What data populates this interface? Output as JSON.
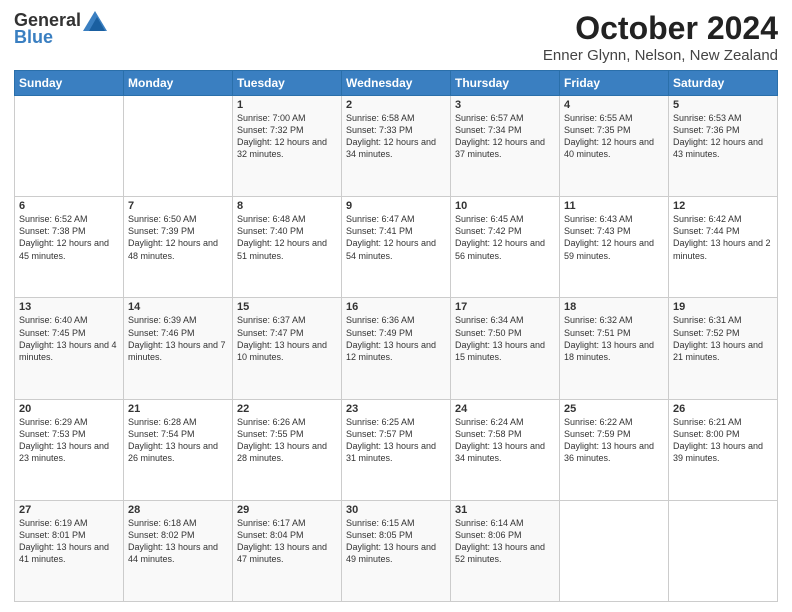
{
  "header": {
    "logo_general": "General",
    "logo_blue": "Blue",
    "title": "October 2024",
    "subtitle": "Enner Glynn, Nelson, New Zealand"
  },
  "days_of_week": [
    "Sunday",
    "Monday",
    "Tuesday",
    "Wednesday",
    "Thursday",
    "Friday",
    "Saturday"
  ],
  "weeks": [
    [
      {
        "day": "",
        "info": ""
      },
      {
        "day": "",
        "info": ""
      },
      {
        "day": "1",
        "info": "Sunrise: 7:00 AM\nSunset: 7:32 PM\nDaylight: 12 hours and 32 minutes."
      },
      {
        "day": "2",
        "info": "Sunrise: 6:58 AM\nSunset: 7:33 PM\nDaylight: 12 hours and 34 minutes."
      },
      {
        "day": "3",
        "info": "Sunrise: 6:57 AM\nSunset: 7:34 PM\nDaylight: 12 hours and 37 minutes."
      },
      {
        "day": "4",
        "info": "Sunrise: 6:55 AM\nSunset: 7:35 PM\nDaylight: 12 hours and 40 minutes."
      },
      {
        "day": "5",
        "info": "Sunrise: 6:53 AM\nSunset: 7:36 PM\nDaylight: 12 hours and 43 minutes."
      }
    ],
    [
      {
        "day": "6",
        "info": "Sunrise: 6:52 AM\nSunset: 7:38 PM\nDaylight: 12 hours and 45 minutes."
      },
      {
        "day": "7",
        "info": "Sunrise: 6:50 AM\nSunset: 7:39 PM\nDaylight: 12 hours and 48 minutes."
      },
      {
        "day": "8",
        "info": "Sunrise: 6:48 AM\nSunset: 7:40 PM\nDaylight: 12 hours and 51 minutes."
      },
      {
        "day": "9",
        "info": "Sunrise: 6:47 AM\nSunset: 7:41 PM\nDaylight: 12 hours and 54 minutes."
      },
      {
        "day": "10",
        "info": "Sunrise: 6:45 AM\nSunset: 7:42 PM\nDaylight: 12 hours and 56 minutes."
      },
      {
        "day": "11",
        "info": "Sunrise: 6:43 AM\nSunset: 7:43 PM\nDaylight: 12 hours and 59 minutes."
      },
      {
        "day": "12",
        "info": "Sunrise: 6:42 AM\nSunset: 7:44 PM\nDaylight: 13 hours and 2 minutes."
      }
    ],
    [
      {
        "day": "13",
        "info": "Sunrise: 6:40 AM\nSunset: 7:45 PM\nDaylight: 13 hours and 4 minutes."
      },
      {
        "day": "14",
        "info": "Sunrise: 6:39 AM\nSunset: 7:46 PM\nDaylight: 13 hours and 7 minutes."
      },
      {
        "day": "15",
        "info": "Sunrise: 6:37 AM\nSunset: 7:47 PM\nDaylight: 13 hours and 10 minutes."
      },
      {
        "day": "16",
        "info": "Sunrise: 6:36 AM\nSunset: 7:49 PM\nDaylight: 13 hours and 12 minutes."
      },
      {
        "day": "17",
        "info": "Sunrise: 6:34 AM\nSunset: 7:50 PM\nDaylight: 13 hours and 15 minutes."
      },
      {
        "day": "18",
        "info": "Sunrise: 6:32 AM\nSunset: 7:51 PM\nDaylight: 13 hours and 18 minutes."
      },
      {
        "day": "19",
        "info": "Sunrise: 6:31 AM\nSunset: 7:52 PM\nDaylight: 13 hours and 21 minutes."
      }
    ],
    [
      {
        "day": "20",
        "info": "Sunrise: 6:29 AM\nSunset: 7:53 PM\nDaylight: 13 hours and 23 minutes."
      },
      {
        "day": "21",
        "info": "Sunrise: 6:28 AM\nSunset: 7:54 PM\nDaylight: 13 hours and 26 minutes."
      },
      {
        "day": "22",
        "info": "Sunrise: 6:26 AM\nSunset: 7:55 PM\nDaylight: 13 hours and 28 minutes."
      },
      {
        "day": "23",
        "info": "Sunrise: 6:25 AM\nSunset: 7:57 PM\nDaylight: 13 hours and 31 minutes."
      },
      {
        "day": "24",
        "info": "Sunrise: 6:24 AM\nSunset: 7:58 PM\nDaylight: 13 hours and 34 minutes."
      },
      {
        "day": "25",
        "info": "Sunrise: 6:22 AM\nSunset: 7:59 PM\nDaylight: 13 hours and 36 minutes."
      },
      {
        "day": "26",
        "info": "Sunrise: 6:21 AM\nSunset: 8:00 PM\nDaylight: 13 hours and 39 minutes."
      }
    ],
    [
      {
        "day": "27",
        "info": "Sunrise: 6:19 AM\nSunset: 8:01 PM\nDaylight: 13 hours and 41 minutes."
      },
      {
        "day": "28",
        "info": "Sunrise: 6:18 AM\nSunset: 8:02 PM\nDaylight: 13 hours and 44 minutes."
      },
      {
        "day": "29",
        "info": "Sunrise: 6:17 AM\nSunset: 8:04 PM\nDaylight: 13 hours and 47 minutes."
      },
      {
        "day": "30",
        "info": "Sunrise: 6:15 AM\nSunset: 8:05 PM\nDaylight: 13 hours and 49 minutes."
      },
      {
        "day": "31",
        "info": "Sunrise: 6:14 AM\nSunset: 8:06 PM\nDaylight: 13 hours and 52 minutes."
      },
      {
        "day": "",
        "info": ""
      },
      {
        "day": "",
        "info": ""
      }
    ]
  ]
}
